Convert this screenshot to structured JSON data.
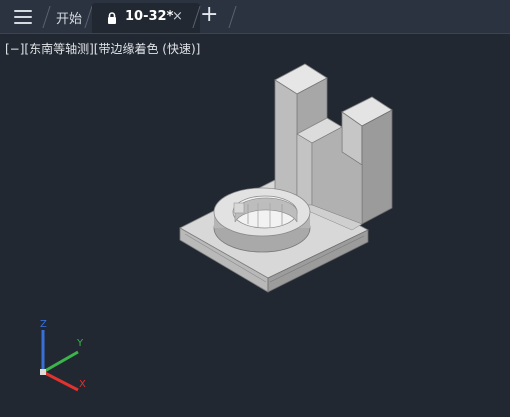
{
  "tabs": {
    "start_label": "开始",
    "active_label": "10-32*",
    "close_symbol": "×",
    "add_symbol": "+"
  },
  "viewport": {
    "control": "[−]",
    "view": "[东南等轴测]",
    "style": "[带边缘着色 (快速)]"
  },
  "ucs": {
    "x_label": "X",
    "y_label": "Y",
    "z_label": "Z",
    "colors": {
      "x": "#e0322e",
      "y": "#3cb44b",
      "z": "#3b6fd8"
    }
  },
  "icons": {
    "menu": "hamburger-menu-icon",
    "lock": "lock-icon",
    "close": "close-icon",
    "add": "plus-icon"
  }
}
